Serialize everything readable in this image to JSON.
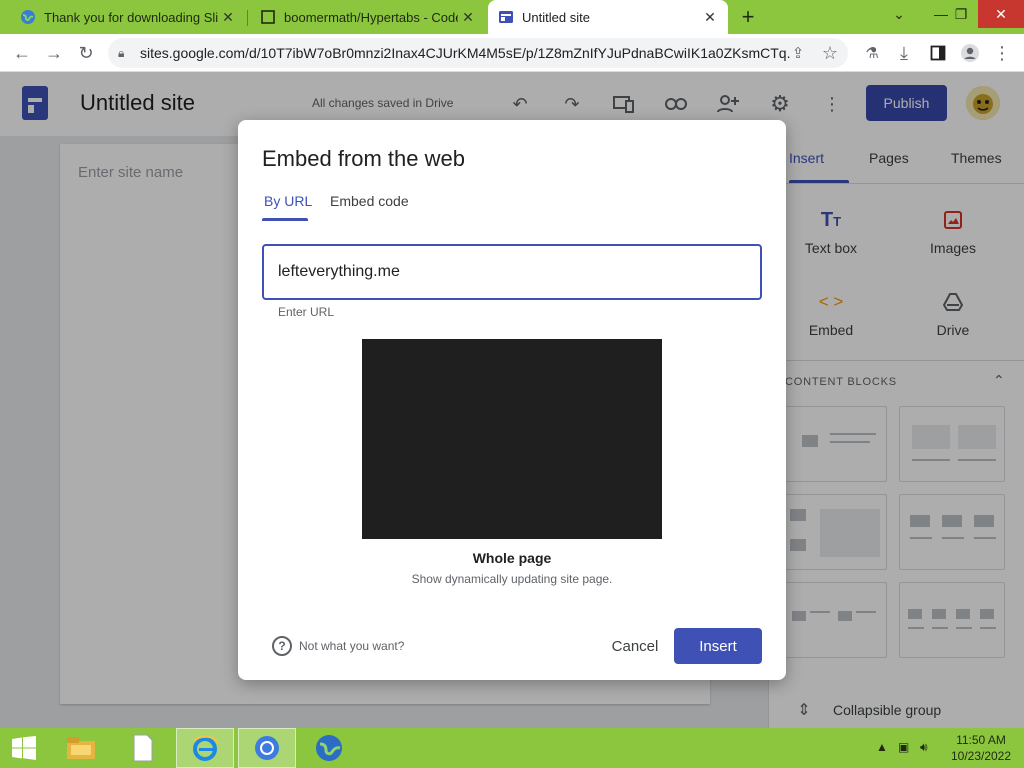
{
  "browser": {
    "tabs": [
      {
        "title": "Thank you for downloading Slim",
        "favicon": "globe-icon",
        "active": false
      },
      {
        "title": "boomermath/Hypertabs - CodeS",
        "favicon": "codesandbox-icon",
        "active": false
      },
      {
        "title": "Untitled site",
        "favicon": "sites-icon",
        "active": true
      }
    ],
    "url": "sites.google.com/d/10T7ibW7oBr0mnzi2Inax4CJUrKM4M5sE/p/1Z8mZnIfYJuPdnaBCwiIK1a0ZKsmCTq..."
  },
  "app": {
    "site_title": "Untitled site",
    "save_status": "All changes saved in Drive",
    "publish_label": "Publish"
  },
  "canvas": {
    "site_name_placeholder": "Enter site name"
  },
  "side_panel": {
    "tabs": [
      "Insert",
      "Pages",
      "Themes"
    ],
    "tools": [
      "Text box",
      "Images",
      "Embed",
      "Drive"
    ],
    "content_blocks_title": "CONTENT BLOCKS",
    "collapsible_label": "Collapsible group"
  },
  "dialog": {
    "title": "Embed from the web",
    "tabs": [
      "By URL",
      "Embed code"
    ],
    "url_value": "lefteverything.me",
    "url_helper": "Enter URL",
    "preview_title": "Whole page",
    "preview_desc": "Show dynamically updating site page.",
    "help_text": "Not what you want?",
    "cancel_label": "Cancel",
    "insert_label": "Insert"
  },
  "taskbar": {
    "time": "11:50 AM",
    "date": "10/23/2022"
  },
  "colors": {
    "accent": "#3f51b5",
    "chrome_frame": "#8cc63f",
    "close_red": "#c7372f"
  }
}
